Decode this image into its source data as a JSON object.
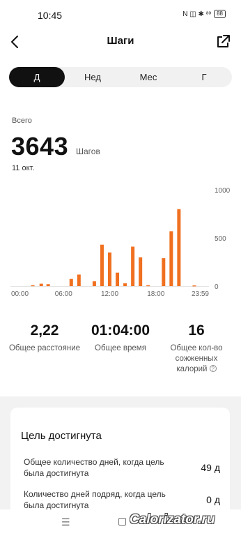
{
  "status_bar": {
    "time": "10:45",
    "icons": "N ◫ ✱ ᵊᵊ",
    "battery": "88"
  },
  "header": {
    "title": "Шаги"
  },
  "tabs": [
    {
      "label": "Д",
      "active": true
    },
    {
      "label": "Нед",
      "active": false
    },
    {
      "label": "Мес",
      "active": false
    },
    {
      "label": "Г",
      "active": false
    }
  ],
  "summary": {
    "label": "Всего",
    "value": "3643",
    "unit": "Шагов",
    "date": "11 окт."
  },
  "chart_data": {
    "type": "bar",
    "x_ticks": [
      "00:00",
      "06:00",
      "12:00",
      "18:00",
      "23:59"
    ],
    "y_ticks": [
      "1000",
      "500",
      "0"
    ],
    "ylim": [
      0,
      1000
    ],
    "xlim": [
      0,
      24
    ],
    "bar_color": "#f07020",
    "bars": [
      {
        "hour": 2.0,
        "value": 10
      },
      {
        "hour": 3.1,
        "value": 25
      },
      {
        "hour": 4.0,
        "value": 20
      },
      {
        "hour": 7.0,
        "value": 75
      },
      {
        "hour": 8.0,
        "value": 120
      },
      {
        "hour": 10.0,
        "value": 50
      },
      {
        "hour": 11.0,
        "value": 430
      },
      {
        "hour": 12.0,
        "value": 350
      },
      {
        "hour": 13.0,
        "value": 140
      },
      {
        "hour": 14.0,
        "value": 30
      },
      {
        "hour": 15.0,
        "value": 410
      },
      {
        "hour": 16.0,
        "value": 300
      },
      {
        "hour": 17.0,
        "value": 10
      },
      {
        "hour": 19.0,
        "value": 290
      },
      {
        "hour": 20.0,
        "value": 570
      },
      {
        "hour": 21.0,
        "value": 800
      },
      {
        "hour": 23.0,
        "value": 8
      }
    ]
  },
  "stats": [
    {
      "value": "2,22",
      "label": "Общее расстояние"
    },
    {
      "value": "01:04:00",
      "label": "Общее время"
    },
    {
      "value": "16",
      "label": "Общее кол-во сожженных калорий"
    }
  ],
  "goal": {
    "title": "Цель достигнута",
    "rows": [
      {
        "label": "Общее количество дней, когда цель была достигнута",
        "value": "49 д"
      },
      {
        "label": "Количество дней подряд, когда цель была достигнута",
        "value": "0 д"
      }
    ]
  },
  "nav": {
    "menu_icon": "☰",
    "watermark": "Calorizator.ru"
  }
}
